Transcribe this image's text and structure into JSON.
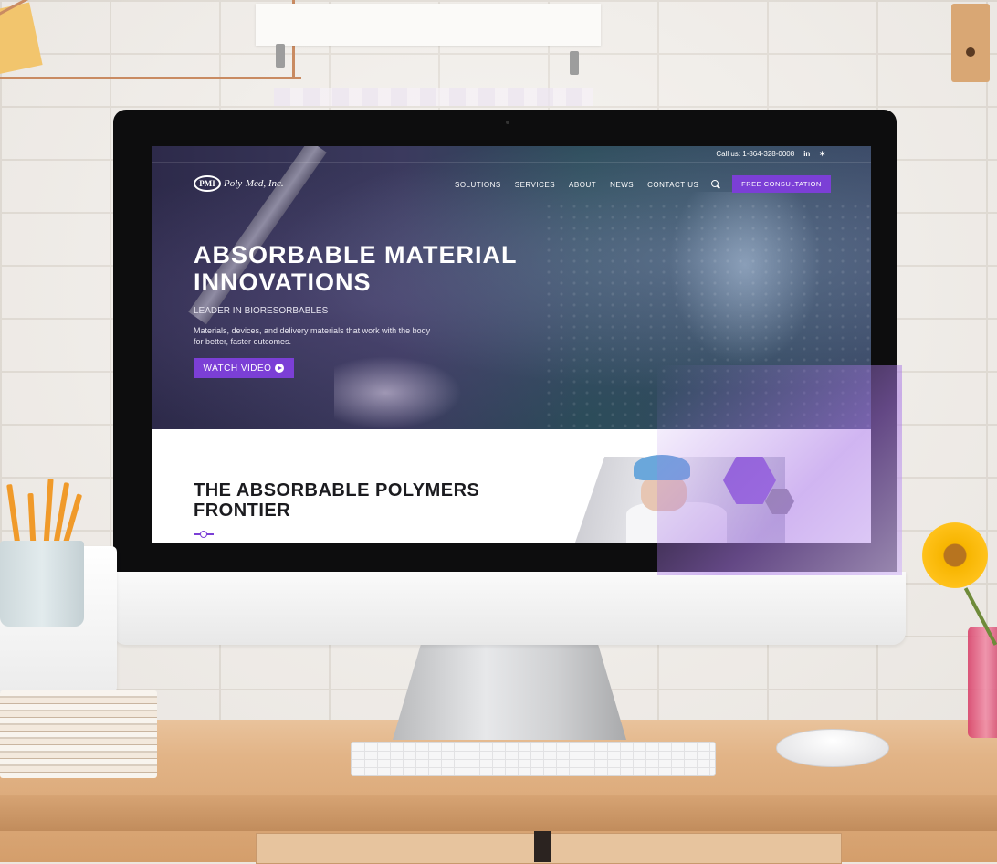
{
  "topbar": {
    "phone": "Call us: 1-864-328-0008",
    "linkedin_icon": "linkedin-icon",
    "twitter_icon": "twitter-icon"
  },
  "logo": {
    "mark": "PMI",
    "name": "Poly-Med, Inc."
  },
  "nav": {
    "solutions": "SOLUTIONS",
    "services": "SERVICES",
    "about": "ABOUT",
    "news": "NEWS",
    "contact": "CONTACT US",
    "search_icon": "search-icon",
    "cta": "FREE CONSULTATION"
  },
  "hero": {
    "title": "ABSORBABLE MATERIAL INNOVATIONS",
    "kicker": "LEADER IN BIORESORBABLES",
    "description": "Materials, devices, and delivery materials that work with the body for better, faster outcomes.",
    "video_button": "WATCH VIDEO",
    "play_icon": "play-circle-icon"
  },
  "section": {
    "title": "THE ABSORBABLE POLYMERS FRONTIER"
  },
  "colors": {
    "accent": "#7b3fd6",
    "hero_overlay": "#2d2a4a",
    "text_dark": "#1b1b1f"
  }
}
